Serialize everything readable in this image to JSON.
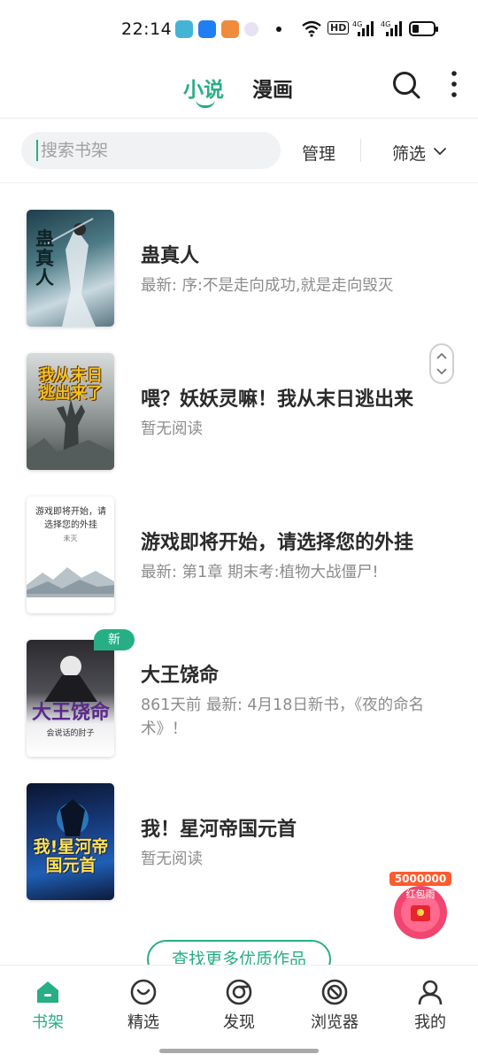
{
  "status_bar": {
    "time": "22:14",
    "icons": [
      "app-notification-icon",
      "wifi-icon",
      "hd-icon",
      "signal-icon",
      "battery-icon"
    ],
    "network_label_1": "4G",
    "network_label_2": "4G",
    "hd_label": "HD"
  },
  "header": {
    "tabs": [
      {
        "label": "小说",
        "active": true
      },
      {
        "label": "漫画",
        "active": false
      }
    ]
  },
  "search": {
    "placeholder": "搜索书架",
    "manage_label": "管理",
    "filter_label": "筛选"
  },
  "books": [
    {
      "title": "蛊真人",
      "subtitle": "最新: 序:不是走向成功,就是走向毁灭",
      "badge": "",
      "cover_text": "蛊真人"
    },
    {
      "title": "喂？妖妖灵嘛！我从末日逃出来",
      "subtitle": "暂无阅读",
      "badge": "",
      "cover_text": "我从末日逃出来了"
    },
    {
      "title": "游戏即将开始，请选择您的外挂",
      "subtitle": "最新: 第1章 期末考:植物大战僵尸!",
      "badge": "",
      "cover_text": "游戏即将开始，请选择您的外挂",
      "cover_author": "未灭"
    },
    {
      "title": "大王饶命",
      "subtitle": "861天前 最新: 4月18日新书，《夜的命名术》！",
      "badge": "新",
      "cover_text": "大王饶命",
      "cover_tagline": "会说话的肘子"
    },
    {
      "title": "我！星河帝国元首",
      "subtitle": "暂无阅读",
      "badge": "",
      "cover_text": "我!星河帝国元首"
    }
  ],
  "more_button": "查找更多优质作品",
  "red_packet": {
    "amount": "5000000",
    "label": "红包雨"
  },
  "bottom_nav": [
    {
      "label": "书架",
      "icon": "bookshelf-home-icon",
      "active": true
    },
    {
      "label": "精选",
      "icon": "heart-badge-icon",
      "active": false
    },
    {
      "label": "发现",
      "icon": "discover-compass-icon",
      "active": false
    },
    {
      "label": "浏览器",
      "icon": "browser-icon",
      "active": false
    },
    {
      "label": "我的",
      "icon": "profile-icon",
      "active": false
    }
  ],
  "colors": {
    "accent": "#27ae85",
    "text": "#2a2a2a",
    "muted": "#8c8c8c"
  }
}
